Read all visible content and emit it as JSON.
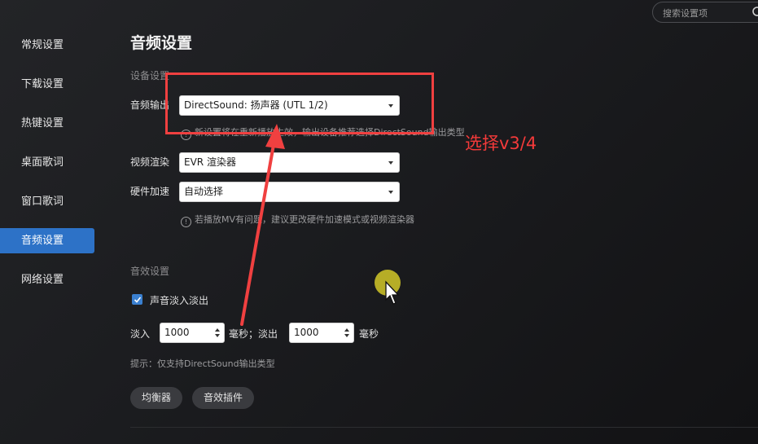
{
  "search": {
    "placeholder": "搜索设置项"
  },
  "sidebar": {
    "items": [
      {
        "label": "常规设置"
      },
      {
        "label": "下载设置"
      },
      {
        "label": "热键设置"
      },
      {
        "label": "桌面歌词"
      },
      {
        "label": "窗口歌词"
      },
      {
        "label": "音频设置",
        "active": true
      },
      {
        "label": "网络设置"
      }
    ]
  },
  "main": {
    "title": "音频设置",
    "device_section": "设备设置",
    "audio_output_label": "音频输出",
    "audio_output_value": "DirectSound: 扬声器 (UTL 1/2)",
    "audio_output_hint": "新设置将在重新播放生效，输出设备推荐选择DirectSound输出类型",
    "video_render_label": "视频渲染",
    "video_render_value": "EVR 渲染器",
    "hw_accel_label": "硬件加速",
    "hw_accel_value": "自动选择",
    "hw_hint": "若播放MV有问题，建议更改硬件加速模式或视频渲染器",
    "effects_section": "音效设置",
    "fade_checkbox_label": "声音淡入淡出",
    "fade_checked": true,
    "fade_in_label": "淡入",
    "fade_in_value": "1000",
    "fade_out_label": "毫秒；淡出",
    "fade_out_value": "1000",
    "ms_label": "毫秒",
    "tip": "提示：仅支持DirectSound输出类型",
    "equalizer_button": "均衡器",
    "plugin_button": "音效插件"
  },
  "annotation": {
    "text": "选择v3/4",
    "color": "#f04040"
  }
}
